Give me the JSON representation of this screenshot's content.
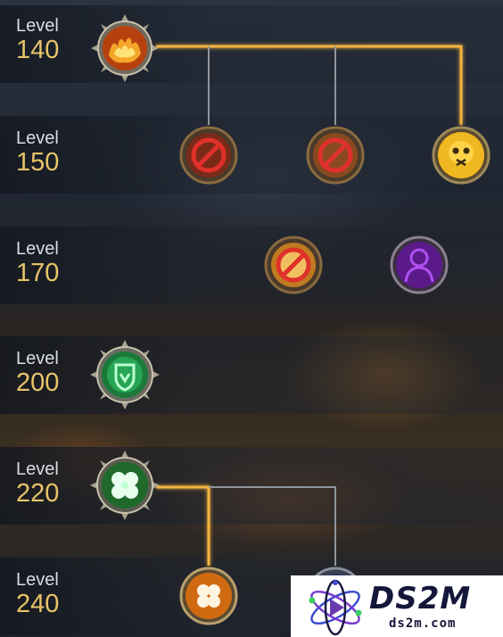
{
  "levels": [
    {
      "word": "Level",
      "number": "140"
    },
    {
      "word": "Level",
      "number": "150"
    },
    {
      "word": "Level",
      "number": "170"
    },
    {
      "word": "Level",
      "number": "200"
    },
    {
      "word": "Level",
      "number": "220"
    },
    {
      "word": "Level",
      "number": "240"
    }
  ],
  "nodes": {
    "r140_main": {
      "icon": "fire-fists-icon",
      "state": "unlocked"
    },
    "r150_a": {
      "icon": "forbidden-icon",
      "state": "locked"
    },
    "r150_b": {
      "icon": "forbidden-icon",
      "state": "locked"
    },
    "r150_c": {
      "icon": "yellow-skull-icon",
      "state": "unlocked"
    },
    "r170_a": {
      "icon": "forbidden-icon",
      "state": "locked"
    },
    "r170_b": {
      "icon": "purple-figure-icon",
      "state": "available"
    },
    "r200_main": {
      "icon": "green-shield-icon",
      "state": "unlocked"
    },
    "r220_main": {
      "icon": "clover-icon",
      "state": "unlocked"
    },
    "r240_a": {
      "icon": "orange-clover-icon",
      "state": "unlocked"
    }
  },
  "colors": {
    "level_text": "#d9dde3",
    "level_number": "#e8c46a",
    "active_path": "#f2b440",
    "inactive_path": "#8f959c"
  },
  "watermark": {
    "title": "DS2M",
    "subtitle": "ds2m.com"
  }
}
